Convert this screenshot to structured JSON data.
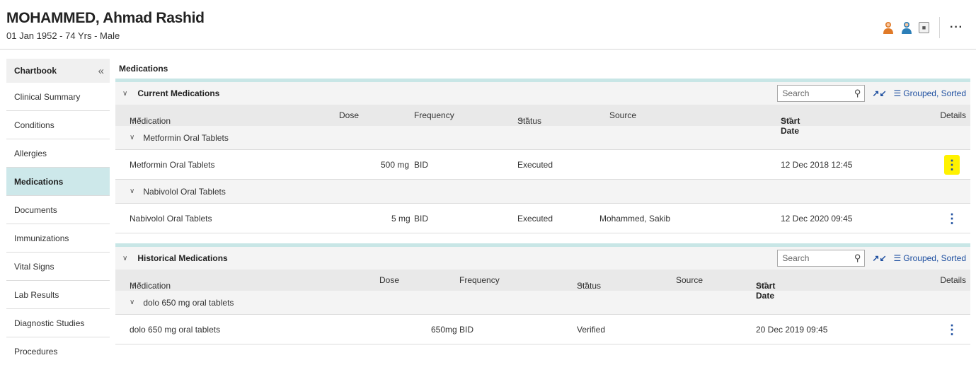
{
  "patient": {
    "name": "MOHAMMED, Ahmad Rashid",
    "details": "01 Jan 1952 - 74 Yrs - Male"
  },
  "header_icons": [
    "female-person-icon",
    "male-person-icon",
    "lock-icon",
    "more-icon"
  ],
  "sidebar": {
    "title": "Chartbook",
    "items": [
      {
        "label": "Clinical Summary",
        "active": false
      },
      {
        "label": "Conditions",
        "active": false
      },
      {
        "label": "Allergies",
        "active": false
      },
      {
        "label": "Medications",
        "active": true
      },
      {
        "label": "Documents",
        "active": false
      },
      {
        "label": "Immunizations",
        "active": false
      },
      {
        "label": "Vital Signs",
        "active": false
      },
      {
        "label": "Lab Results",
        "active": false
      },
      {
        "label": "Diagnostic Studies",
        "active": false
      },
      {
        "label": "Procedures",
        "active": false
      }
    ]
  },
  "main": {
    "title": "Medications",
    "current": {
      "title": "Current Medications",
      "search_placeholder": "Search",
      "grouped_label": "Grouped, Sorted",
      "columns": {
        "medication": "Medication",
        "dose": "Dose",
        "frequency": "Frequency",
        "status": "Status",
        "source": "Source",
        "start_date": "Start Date",
        "details": "Details"
      },
      "groups": [
        {
          "name": "Metformin Oral Tablets",
          "row": {
            "medication": "Metformin Oral Tablets",
            "dose": "500 mg",
            "frequency": "BID",
            "status": "Executed",
            "source": "",
            "start_date": "12 Dec 2018 12:45"
          }
        },
        {
          "name": "Nabivolol Oral Tablets",
          "row": {
            "medication": "Nabivolol Oral Tablets",
            "dose": "5 mg",
            "frequency": "BID",
            "status": "Executed",
            "source": "Mohammed, Sakib",
            "start_date": "12 Dec 2020 09:45"
          }
        }
      ]
    },
    "historical": {
      "title": "Historical Medications",
      "search_placeholder": "Search",
      "grouped_label": "Grouped, Sorted",
      "columns": {
        "medication": "Medication",
        "dose": "Dose",
        "frequency": "Frequency",
        "status": "Status",
        "source": "Source",
        "start_date": "Start Date",
        "details": "Details"
      },
      "groups": [
        {
          "name": "dolo 650 mg oral tablets",
          "row": {
            "medication": "dolo 650 mg oral tablets",
            "dose": "650mg",
            "frequency": "BID",
            "status": "Verified",
            "source": "",
            "start_date": "20 Dec 2019 09:45"
          }
        }
      ]
    }
  },
  "colors": {
    "accent": "#1e4fa0",
    "active_nav": "#cde8ea",
    "section_border": "#c8e6e6",
    "highlight": "#fff200"
  }
}
